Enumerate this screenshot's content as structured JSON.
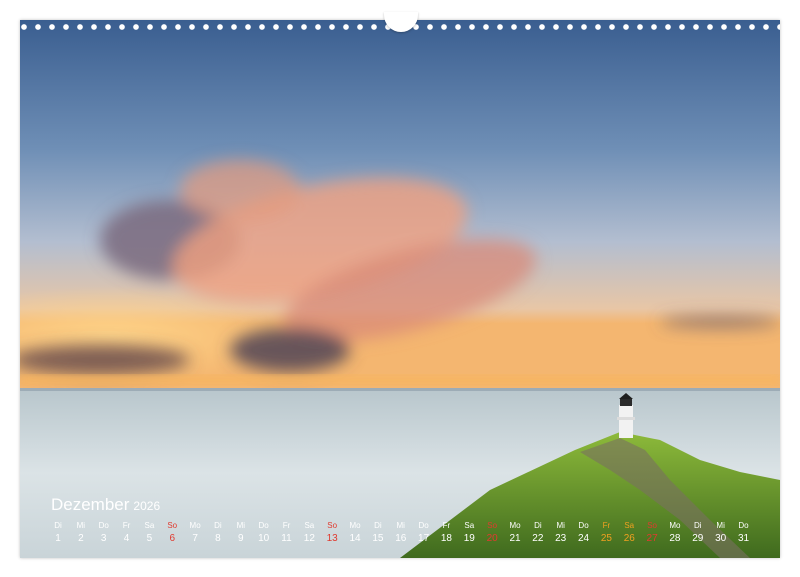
{
  "calendar": {
    "month": "Dezember",
    "year": "2026",
    "days": [
      {
        "wd": "Di",
        "d": "1"
      },
      {
        "wd": "Mi",
        "d": "2"
      },
      {
        "wd": "Do",
        "d": "3"
      },
      {
        "wd": "Fr",
        "d": "4"
      },
      {
        "wd": "Sa",
        "d": "5"
      },
      {
        "wd": "So",
        "d": "6",
        "sun": true
      },
      {
        "wd": "Mo",
        "d": "7"
      },
      {
        "wd": "Di",
        "d": "8"
      },
      {
        "wd": "Mi",
        "d": "9"
      },
      {
        "wd": "Do",
        "d": "10"
      },
      {
        "wd": "Fr",
        "d": "11"
      },
      {
        "wd": "Sa",
        "d": "12"
      },
      {
        "wd": "So",
        "d": "13",
        "sun": true
      },
      {
        "wd": "Mo",
        "d": "14"
      },
      {
        "wd": "Di",
        "d": "15"
      },
      {
        "wd": "Mi",
        "d": "16"
      },
      {
        "wd": "Do",
        "d": "17"
      },
      {
        "wd": "Fr",
        "d": "18"
      },
      {
        "wd": "Sa",
        "d": "19"
      },
      {
        "wd": "So",
        "d": "20",
        "sun": true
      },
      {
        "wd": "Mo",
        "d": "21"
      },
      {
        "wd": "Di",
        "d": "22"
      },
      {
        "wd": "Mi",
        "d": "23"
      },
      {
        "wd": "Do",
        "d": "24"
      },
      {
        "wd": "Fr",
        "d": "25",
        "holiday": true
      },
      {
        "wd": "Sa",
        "d": "26",
        "holiday": true
      },
      {
        "wd": "So",
        "d": "27",
        "sun": true
      },
      {
        "wd": "Mo",
        "d": "28"
      },
      {
        "wd": "Di",
        "d": "29"
      },
      {
        "wd": "Mi",
        "d": "30"
      },
      {
        "wd": "Do",
        "d": "31"
      }
    ]
  },
  "colors": {
    "sunday": "#e03a2f",
    "holiday": "#f0a020",
    "text": "#ffffff"
  }
}
